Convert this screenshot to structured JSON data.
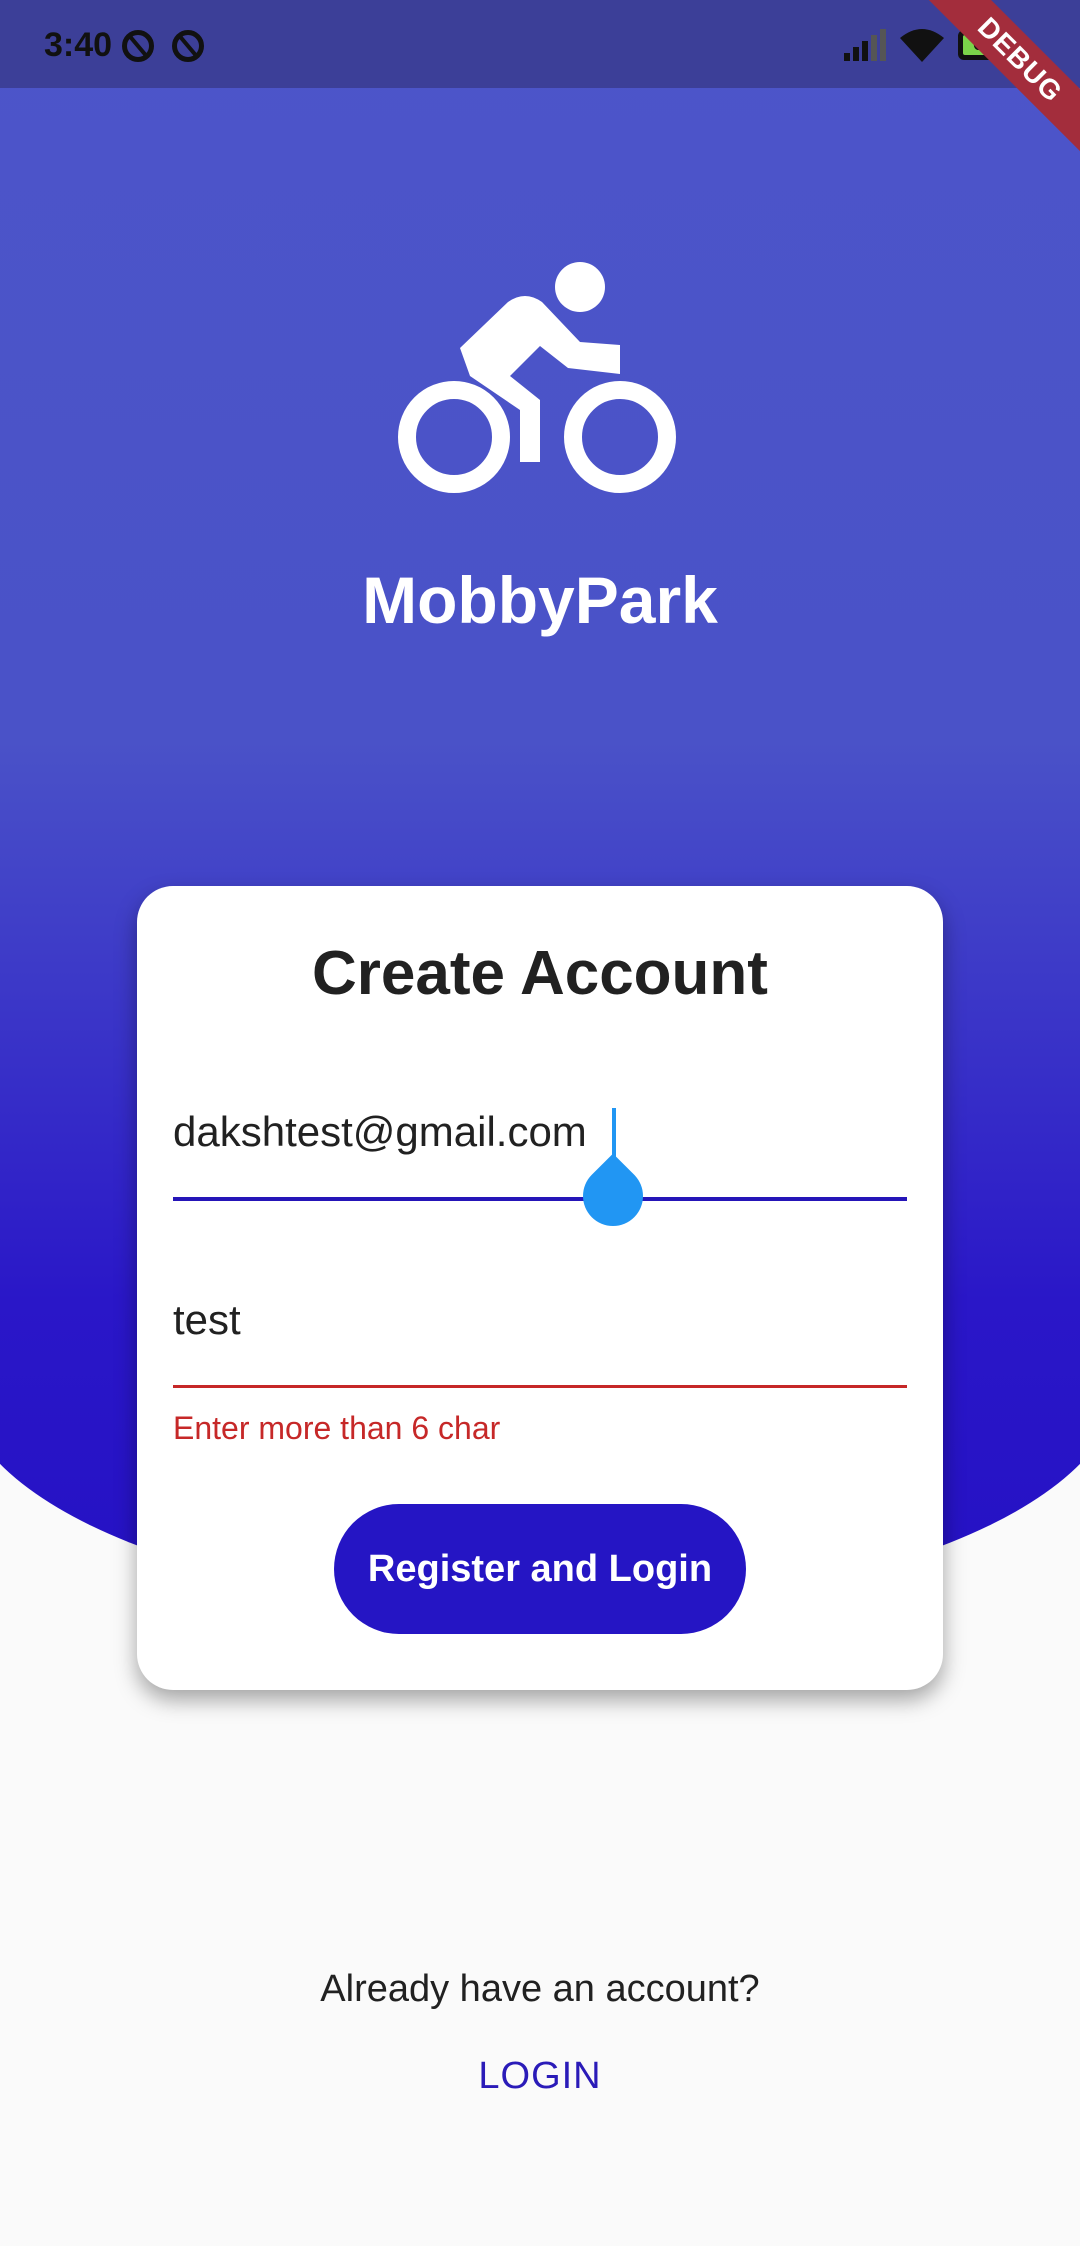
{
  "status_bar": {
    "time": "3:40",
    "battery_level": "65",
    "debug_label": "DEBUG",
    "icons": [
      "sync-icon",
      "sync-icon",
      "signal-icon",
      "wifi-icon",
      "battery-icon"
    ]
  },
  "app": {
    "name": "MobbyPark",
    "logo_icon": "bike-icon"
  },
  "form": {
    "title": "Create Account",
    "email_value": "dakshtest@gmail.com",
    "password_value": "test",
    "password_error": "Enter more than 6 char",
    "submit_label": "Register and Login"
  },
  "footer": {
    "question": "Already have an account?",
    "login_label": "LOGIN"
  },
  "colors": {
    "primary": "#2515c4",
    "hero_top": "#4c55c9",
    "error": "#c62828",
    "cursor": "#2196f3"
  }
}
